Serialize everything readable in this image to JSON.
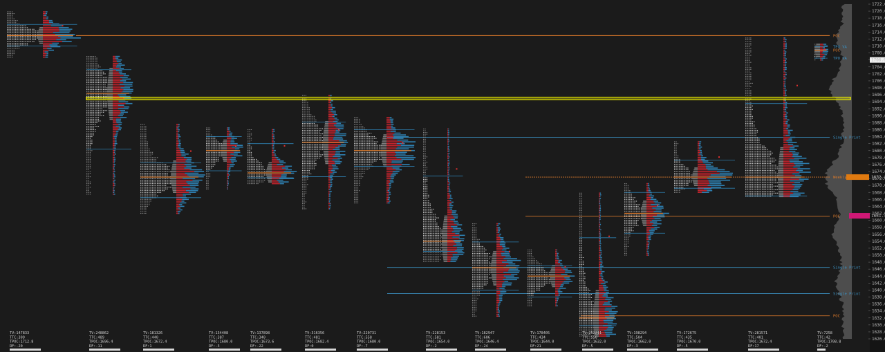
{
  "chart_data": {
    "type": "market_profile",
    "price_axis": {
      "min": 1626,
      "max": 1722,
      "step": 2,
      "tick_labels": [
        "1722.0",
        "1720.0",
        "1718.0",
        "1716.0",
        "1714.0",
        "1712.0",
        "1710.0",
        "1708.0",
        "1706.0",
        "1704.0",
        "1702.0",
        "1700.0",
        "1698.0",
        "1696.0",
        "1694.0",
        "1692.0",
        "1690.0",
        "1688.0",
        "1686.0",
        "1684.0",
        "1682.0",
        "1680.0",
        "1678.0",
        "1676.0",
        "1674.0",
        "1672.0",
        "1670.0",
        "1668.0",
        "1666.0",
        "1664.0",
        "1662.0",
        "1660.0",
        "1658.0",
        "1656.0",
        "1654.0",
        "1652.0",
        "1650.0",
        "1648.0",
        "1646.0",
        "1644.0",
        "1642.0",
        "1640.0",
        "1638.0",
        "1636.0",
        "1634.0",
        "1632.0",
        "1630.0",
        "1628.0",
        "1626.0"
      ],
      "current_price_label": "1706.0",
      "weekly_vpoc_label": "1672.4",
      "poc_tag_label": "1661.3"
    },
    "reference_lines": [
      {
        "label": "POC",
        "price": 1713.0,
        "color": "#d9792b"
      },
      {
        "label": "Weekly VPOC",
        "price": 1672.4,
        "color": "#d9792b"
      },
      {
        "label": "POC",
        "price": 1661.2,
        "color": "#d9792b"
      },
      {
        "label": "Single Print",
        "price": 1683.8,
        "color": "#3b8fc0"
      },
      {
        "label": "Single Print",
        "price": 1646.5,
        "color": "#3b8fc0"
      },
      {
        "label": "Single Print",
        "price": 1639.0,
        "color": "#3b8fc0"
      },
      {
        "label": "POC",
        "price": 1632.6,
        "color": "#d9792b"
      }
    ],
    "highlight_band": {
      "price_high": 1695.3,
      "price_low": 1694.6,
      "color": "#e6e600"
    },
    "tpo_va_labels": {
      "upper": "TPO VA",
      "poc": "POC",
      "lower": "TPO VA"
    },
    "sessions": [
      {
        "tv": "TV:147833",
        "ttc": "TTC:309",
        "tpoc": "TPOC:1712.8",
        "rf": "RF:-20",
        "high": 1719.8,
        "low": 1706.5,
        "poc": 1713.0,
        "vah": 1716.2,
        "val": 1710.0
      },
      {
        "tv": "TV:248862",
        "ttc": "TTC:489",
        "tpoc": "TPOC:1696.4",
        "rf": "RF:-11",
        "high": 1707.0,
        "low": 1667.3,
        "poc": 1696.4,
        "vah": 1703.2,
        "val": 1680.4
      },
      {
        "tv": "TV:181326",
        "ttc": "TTC:440",
        "tpoc": "TPOC:1672.4",
        "rf": "RF:1",
        "high": 1687.5,
        "low": 1662.0,
        "poc": 1672.4,
        "vah": 1676.5,
        "val": 1666.5
      },
      {
        "tv": "TV:134408",
        "ttc": "TTC:387",
        "tpoc": "TPOC:1680.0",
        "rf": "RF:-3",
        "high": 1686.5,
        "low": 1669.0,
        "poc": 1680.0,
        "vah": 1684.0,
        "val": 1674.2
      },
      {
        "tv": "TV:137898",
        "ttc": "TTC:340",
        "tpoc": "TPOC:1673.6",
        "rf": "RF:-22",
        "high": 1686.0,
        "low": 1670.5,
        "poc": 1673.6,
        "vah": 1682.0,
        "val": 1672.2
      },
      {
        "tv": "TV:316356",
        "ttc": "TTC:481",
        "tpoc": "TPOC:1682.4",
        "rf": "RF:0",
        "high": 1695.8,
        "low": 1663.0,
        "poc": 1682.4,
        "vah": 1688.2,
        "val": 1672.5
      },
      {
        "tv": "TV:220731",
        "ttc": "TTC:558",
        "tpoc": "TPOC:1680.0",
        "rf": "RF:-7",
        "high": 1689.5,
        "low": 1665.0,
        "poc": 1680.0,
        "vah": 1686.0,
        "val": 1675.5
      },
      {
        "tv": "TV:228153",
        "ttc": "TTC:581",
        "tpoc": "TPOC:1654.0",
        "rf": "RF:-2",
        "high": 1686.2,
        "low": 1648.0,
        "poc": 1654.0,
        "vah": 1672.7,
        "val": 1651.1
      },
      {
        "tv": "TV:182947",
        "ttc": "TTC:606",
        "tpoc": "TPOC:1646.4",
        "rf": "RF:-24",
        "high": 1659.0,
        "low": 1632.5,
        "poc": 1646.4,
        "vah": 1653.8,
        "val": 1640.0
      },
      {
        "tv": "TV:178405",
        "ttc": "TTC:434",
        "tpoc": "TPOC:1644.0",
        "rf": "RF:21",
        "high": 1651.5,
        "low": 1635.2,
        "poc": 1644.0,
        "vah": 1647.0,
        "val": 1638.0
      },
      {
        "tv": "TV:252211",
        "ttc": "TTC:556",
        "tpoc": "TPOC:1632.0",
        "rf": "RF:-5",
        "high": 1667.8,
        "low": 1626.5,
        "poc": 1632.0,
        "vah": 1655.0,
        "val": 1629.8
      },
      {
        "tv": "TV:198294",
        "ttc": "TTC:504",
        "tpoc": "TPOC:1662.0",
        "rf": "RF:-3",
        "high": 1670.5,
        "low": 1650.0,
        "poc": 1662.0,
        "vah": 1668.0,
        "val": 1656.3
      },
      {
        "tv": "TV:172675",
        "ttc": "TTC:435",
        "tpoc": "TPOC:1670.0",
        "rf": "RF:-5",
        "high": 1682.5,
        "low": 1668.0,
        "poc": 1672.4,
        "vah": 1677.3,
        "val": 1669.2
      },
      {
        "tv": "TV:281571",
        "ttc": "TTC:401",
        "tpoc": "TPOC:1672.4",
        "rf": "RF:17",
        "high": 1712.3,
        "low": 1666.8,
        "poc": 1672.4,
        "vah": 1693.5,
        "val": 1667.0
      },
      {
        "tv": "TV:7258",
        "ttc": "TTC:42",
        "tpoc": "TPOC:1708.8",
        "rf": "RF:-2",
        "high": 1710.5,
        "low": 1705.6,
        "poc": 1708.8,
        "vah": 1709.8,
        "val": 1706.5
      }
    ]
  }
}
